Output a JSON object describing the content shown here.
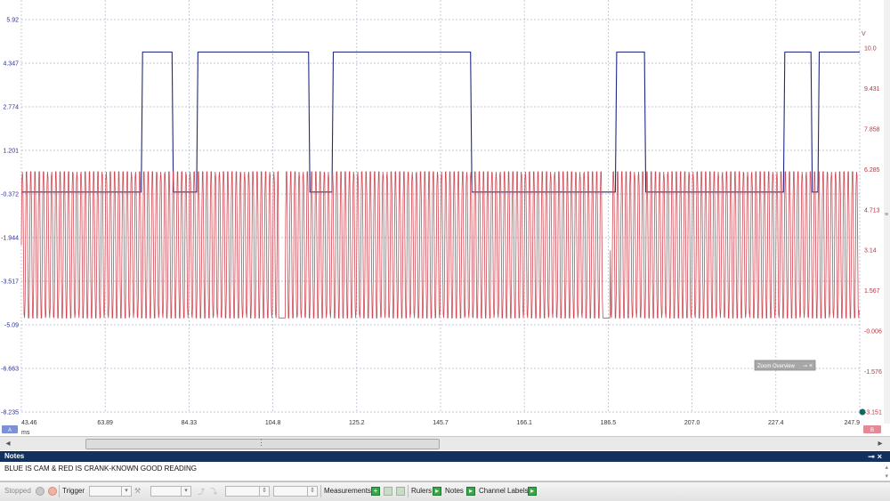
{
  "chart_data": {
    "type": "line",
    "x_unit": "ms",
    "x_ticks": [
      "43.46",
      "63.89",
      "84.33",
      "104.8",
      "125.2",
      "145.7",
      "166.1",
      "186.5",
      "207.0",
      "227.4",
      "247.9"
    ],
    "xlim": [
      43.46,
      247.9
    ],
    "left_axis": {
      "ticks": [
        "5.92",
        "4.347",
        "2.774",
        "1.201",
        "-0.372",
        "-1.944",
        "-3.517",
        "-5.09",
        "-6.663",
        "-8.235"
      ],
      "ylim": [
        -8.235,
        5.92
      ]
    },
    "right_axis": {
      "unit": "V",
      "ticks": [
        "10.0",
        "9.431",
        "7.858",
        "6.285",
        "4.713",
        "3.14",
        "1.567",
        "-0.006",
        "-1.576",
        "-3.151"
      ],
      "ylim": [
        -3.151,
        10.0
      ]
    },
    "series": [
      {
        "axis": "left",
        "color": "#1f2a80",
        "low": -0.3,
        "high": 4.75,
        "high_intervals": [
          [
            72.7,
            80.2
          ],
          [
            86.2,
            113.5
          ],
          [
            119.2,
            153.0
          ],
          [
            188.3,
            195.4
          ],
          [
            229.3,
            236.0
          ],
          [
            237.7,
            247.9
          ]
        ]
      },
      {
        "axis": "right",
        "color": "#d04a55",
        "low": 0.0,
        "high": 4.9,
        "cycles": 58,
        "gaps": [
          [
            106.2,
            107.9
          ],
          [
            185.3,
            187.0
          ]
        ]
      }
    ],
    "grid": true
  },
  "scope": {
    "x_unit_label": "ms",
    "left_badge": "A",
    "right_badge": "B",
    "zoom_overview": {
      "label": "Zoom Overview"
    }
  },
  "notes": {
    "title": "Notes",
    "text": "BLUE IS CAM & RED IS CRANK-KNOWN GOOD READING"
  },
  "toolbar": {
    "status": "Stopped",
    "trigger": "Trigger",
    "measurements": "Measurements",
    "rulers": "Rulers",
    "notes": "Notes",
    "channel_labels": "Channel Labels"
  },
  "colors": {
    "grid": "#aeb8c9",
    "left_axis_text": "#2b2f8a",
    "right_axis_text": "#c0303c",
    "notes_header": "#13315f"
  }
}
